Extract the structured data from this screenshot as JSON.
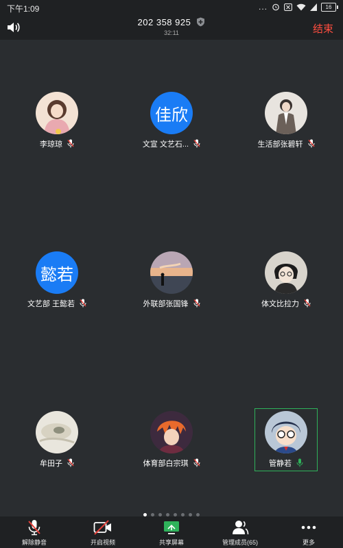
{
  "status_bar": {
    "time": "下午1:09",
    "dots": "...",
    "battery": "16"
  },
  "header": {
    "meeting_id": "202 358 925",
    "timer": "32:11",
    "end_label": "结束"
  },
  "participants": [
    {
      "name": "李琼琼",
      "avatar": "photo",
      "muted": true
    },
    {
      "name": "文宣 文艺石...",
      "avatar": "text",
      "avatar_text": "佳欣",
      "muted": true
    },
    {
      "name": "生活部张碧轩",
      "avatar": "photo",
      "muted": true
    },
    {
      "name": "文艺部 王懿若",
      "avatar": "text",
      "avatar_text": "懿若",
      "muted": true
    },
    {
      "name": "外联部张国锋",
      "avatar": "photo",
      "muted": true
    },
    {
      "name": "体文比拉力",
      "avatar": "photo",
      "muted": true
    },
    {
      "name": "牟田子",
      "avatar": "photo",
      "muted": true
    },
    {
      "name": "体育部白宗琪",
      "avatar": "photo",
      "muted": true
    },
    {
      "name": "管静若",
      "avatar": "photo",
      "muted": false,
      "speaking": true
    }
  ],
  "pagination": {
    "total": 8,
    "current": 1
  },
  "toolbar": {
    "unmute_label": "解除静音",
    "video_label": "开启视频",
    "share_label": "共享屏幕",
    "members_label": "管理成员(65)",
    "more_label": "更多"
  },
  "colors": {
    "accent_blue": "#1a7cf5",
    "end_red": "#ff4d3f",
    "speaking_green": "#2fb35b",
    "muted_red": "#e5403a"
  }
}
